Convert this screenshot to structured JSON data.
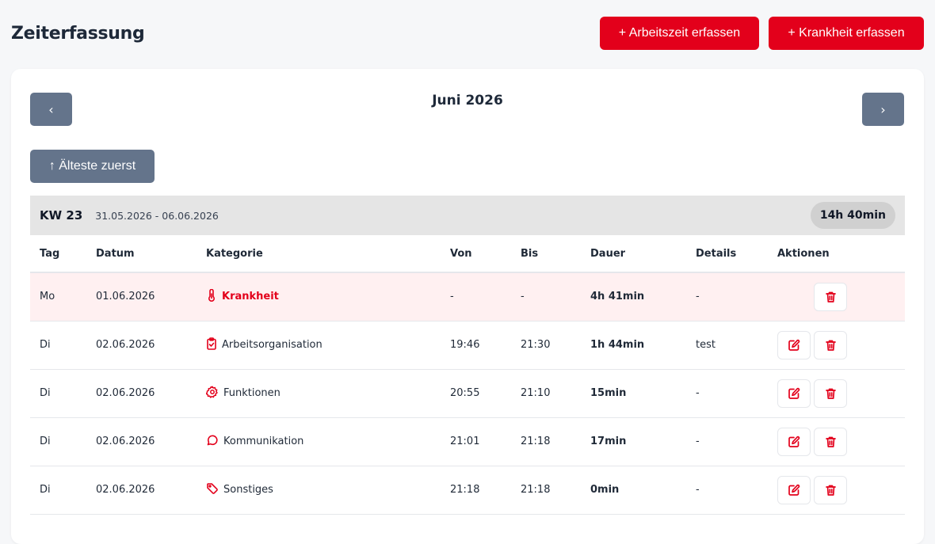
{
  "page": {
    "title": "Zeiterfassung",
    "add_work_label": "+ Arbeitszeit erfassen",
    "add_sick_label": "+ Krankheit erfassen"
  },
  "calendar": {
    "prev_label": "‹",
    "next_label": "›",
    "month_label": "Juni 2026",
    "sort_label": "↑ Älteste zuerst"
  },
  "week": {
    "kw_label": "KW 23",
    "range": "31.05.2026 - 06.06.2026",
    "total": "14h 40min"
  },
  "table": {
    "headers": [
      "Tag",
      "Datum",
      "Kategorie",
      "Von",
      "Bis",
      "Dauer",
      "Details",
      "Aktionen"
    ],
    "rows": [
      {
        "tag": "Mo",
        "datum": "01.06.2026",
        "kategorie": "Krankheit",
        "icon": "thermometer-icon",
        "von": "-",
        "bis": "-",
        "dauer": "4h 41min",
        "details": "-",
        "editable": false
      },
      {
        "tag": "Di",
        "datum": "02.06.2026",
        "kategorie": "Arbeitsorganisation",
        "icon": "clipboard-check-icon",
        "von": "19:46",
        "bis": "21:30",
        "dauer": "1h 44min",
        "details": "test",
        "editable": true
      },
      {
        "tag": "Di",
        "datum": "02.06.2026",
        "kategorie": "Funktionen",
        "icon": "gear-icon",
        "von": "20:55",
        "bis": "21:10",
        "dauer": "15min",
        "details": "-",
        "editable": true
      },
      {
        "tag": "Di",
        "datum": "02.06.2026",
        "kategorie": "Kommunikation",
        "icon": "chat-bubble-icon",
        "von": "21:01",
        "bis": "21:18",
        "dauer": "17min",
        "details": "-",
        "editable": true
      },
      {
        "tag": "Di",
        "datum": "02.06.2026",
        "kategorie": "Sonstiges",
        "icon": "tag-icon",
        "von": "21:18",
        "bis": "21:18",
        "dauer": "0min",
        "details": "-",
        "editable": true
      }
    ]
  },
  "colors": {
    "accent": "#e3001b",
    "nav_button": "#64748b",
    "week_bar": "#e5e5e5",
    "sick_row": "#fff0f1"
  }
}
